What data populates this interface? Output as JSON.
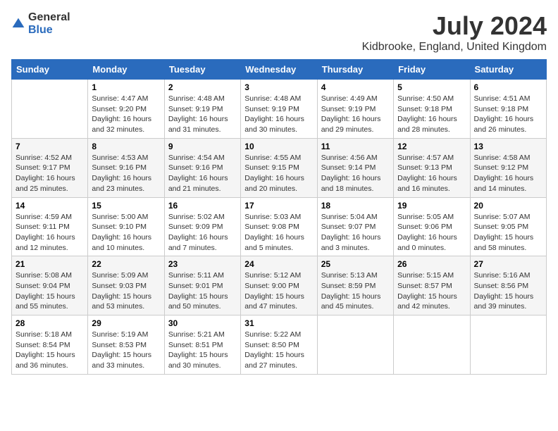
{
  "logo": {
    "general": "General",
    "blue": "Blue"
  },
  "title": "July 2024",
  "location": "Kidbrooke, England, United Kingdom",
  "days_of_week": [
    "Sunday",
    "Monday",
    "Tuesday",
    "Wednesday",
    "Thursday",
    "Friday",
    "Saturday"
  ],
  "weeks": [
    [
      {
        "day": "",
        "sunrise": "",
        "sunset": "",
        "daylight": ""
      },
      {
        "day": "1",
        "sunrise": "Sunrise: 4:47 AM",
        "sunset": "Sunset: 9:20 PM",
        "daylight": "Daylight: 16 hours and 32 minutes."
      },
      {
        "day": "2",
        "sunrise": "Sunrise: 4:48 AM",
        "sunset": "Sunset: 9:19 PM",
        "daylight": "Daylight: 16 hours and 31 minutes."
      },
      {
        "day": "3",
        "sunrise": "Sunrise: 4:48 AM",
        "sunset": "Sunset: 9:19 PM",
        "daylight": "Daylight: 16 hours and 30 minutes."
      },
      {
        "day": "4",
        "sunrise": "Sunrise: 4:49 AM",
        "sunset": "Sunset: 9:19 PM",
        "daylight": "Daylight: 16 hours and 29 minutes."
      },
      {
        "day": "5",
        "sunrise": "Sunrise: 4:50 AM",
        "sunset": "Sunset: 9:18 PM",
        "daylight": "Daylight: 16 hours and 28 minutes."
      },
      {
        "day": "6",
        "sunrise": "Sunrise: 4:51 AM",
        "sunset": "Sunset: 9:18 PM",
        "daylight": "Daylight: 16 hours and 26 minutes."
      }
    ],
    [
      {
        "day": "7",
        "sunrise": "Sunrise: 4:52 AM",
        "sunset": "Sunset: 9:17 PM",
        "daylight": "Daylight: 16 hours and 25 minutes."
      },
      {
        "day": "8",
        "sunrise": "Sunrise: 4:53 AM",
        "sunset": "Sunset: 9:16 PM",
        "daylight": "Daylight: 16 hours and 23 minutes."
      },
      {
        "day": "9",
        "sunrise": "Sunrise: 4:54 AM",
        "sunset": "Sunset: 9:16 PM",
        "daylight": "Daylight: 16 hours and 21 minutes."
      },
      {
        "day": "10",
        "sunrise": "Sunrise: 4:55 AM",
        "sunset": "Sunset: 9:15 PM",
        "daylight": "Daylight: 16 hours and 20 minutes."
      },
      {
        "day": "11",
        "sunrise": "Sunrise: 4:56 AM",
        "sunset": "Sunset: 9:14 PM",
        "daylight": "Daylight: 16 hours and 18 minutes."
      },
      {
        "day": "12",
        "sunrise": "Sunrise: 4:57 AM",
        "sunset": "Sunset: 9:13 PM",
        "daylight": "Daylight: 16 hours and 16 minutes."
      },
      {
        "day": "13",
        "sunrise": "Sunrise: 4:58 AM",
        "sunset": "Sunset: 9:12 PM",
        "daylight": "Daylight: 16 hours and 14 minutes."
      }
    ],
    [
      {
        "day": "14",
        "sunrise": "Sunrise: 4:59 AM",
        "sunset": "Sunset: 9:11 PM",
        "daylight": "Daylight: 16 hours and 12 minutes."
      },
      {
        "day": "15",
        "sunrise": "Sunrise: 5:00 AM",
        "sunset": "Sunset: 9:10 PM",
        "daylight": "Daylight: 16 hours and 10 minutes."
      },
      {
        "day": "16",
        "sunrise": "Sunrise: 5:02 AM",
        "sunset": "Sunset: 9:09 PM",
        "daylight": "Daylight: 16 hours and 7 minutes."
      },
      {
        "day": "17",
        "sunrise": "Sunrise: 5:03 AM",
        "sunset": "Sunset: 9:08 PM",
        "daylight": "Daylight: 16 hours and 5 minutes."
      },
      {
        "day": "18",
        "sunrise": "Sunrise: 5:04 AM",
        "sunset": "Sunset: 9:07 PM",
        "daylight": "Daylight: 16 hours and 3 minutes."
      },
      {
        "day": "19",
        "sunrise": "Sunrise: 5:05 AM",
        "sunset": "Sunset: 9:06 PM",
        "daylight": "Daylight: 16 hours and 0 minutes."
      },
      {
        "day": "20",
        "sunrise": "Sunrise: 5:07 AM",
        "sunset": "Sunset: 9:05 PM",
        "daylight": "Daylight: 15 hours and 58 minutes."
      }
    ],
    [
      {
        "day": "21",
        "sunrise": "Sunrise: 5:08 AM",
        "sunset": "Sunset: 9:04 PM",
        "daylight": "Daylight: 15 hours and 55 minutes."
      },
      {
        "day": "22",
        "sunrise": "Sunrise: 5:09 AM",
        "sunset": "Sunset: 9:03 PM",
        "daylight": "Daylight: 15 hours and 53 minutes."
      },
      {
        "day": "23",
        "sunrise": "Sunrise: 5:11 AM",
        "sunset": "Sunset: 9:01 PM",
        "daylight": "Daylight: 15 hours and 50 minutes."
      },
      {
        "day": "24",
        "sunrise": "Sunrise: 5:12 AM",
        "sunset": "Sunset: 9:00 PM",
        "daylight": "Daylight: 15 hours and 47 minutes."
      },
      {
        "day": "25",
        "sunrise": "Sunrise: 5:13 AM",
        "sunset": "Sunset: 8:59 PM",
        "daylight": "Daylight: 15 hours and 45 minutes."
      },
      {
        "day": "26",
        "sunrise": "Sunrise: 5:15 AM",
        "sunset": "Sunset: 8:57 PM",
        "daylight": "Daylight: 15 hours and 42 minutes."
      },
      {
        "day": "27",
        "sunrise": "Sunrise: 5:16 AM",
        "sunset": "Sunset: 8:56 PM",
        "daylight": "Daylight: 15 hours and 39 minutes."
      }
    ],
    [
      {
        "day": "28",
        "sunrise": "Sunrise: 5:18 AM",
        "sunset": "Sunset: 8:54 PM",
        "daylight": "Daylight: 15 hours and 36 minutes."
      },
      {
        "day": "29",
        "sunrise": "Sunrise: 5:19 AM",
        "sunset": "Sunset: 8:53 PM",
        "daylight": "Daylight: 15 hours and 33 minutes."
      },
      {
        "day": "30",
        "sunrise": "Sunrise: 5:21 AM",
        "sunset": "Sunset: 8:51 PM",
        "daylight": "Daylight: 15 hours and 30 minutes."
      },
      {
        "day": "31",
        "sunrise": "Sunrise: 5:22 AM",
        "sunset": "Sunset: 8:50 PM",
        "daylight": "Daylight: 15 hours and 27 minutes."
      },
      {
        "day": "",
        "sunrise": "",
        "sunset": "",
        "daylight": ""
      },
      {
        "day": "",
        "sunrise": "",
        "sunset": "",
        "daylight": ""
      },
      {
        "day": "",
        "sunrise": "",
        "sunset": "",
        "daylight": ""
      }
    ]
  ]
}
